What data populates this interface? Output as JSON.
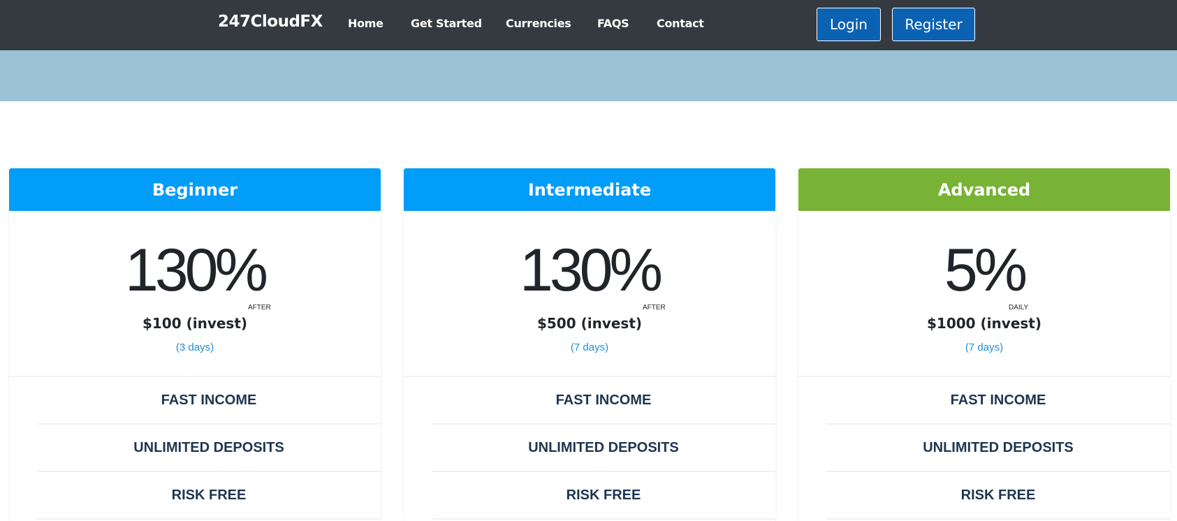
{
  "nav": {
    "brand": "247CloudFX",
    "links": [
      "Home",
      "Get Started",
      "Currencies",
      "FAQS",
      "Contact"
    ],
    "login_label": "Login",
    "register_label": "Register"
  },
  "colors": {
    "navbar": "#343a40",
    "hero_band": "#9cc2d6",
    "beginner_header": "#029cf9",
    "intermediate_header": "#029cf9",
    "advanced_header": "#79b336",
    "duration_text": "#1a8fd9"
  },
  "plans": [
    {
      "name": "Beginner",
      "rate": "130%",
      "tag": "AFTER",
      "invest": "$100 (invest)",
      "duration": "(3 days)",
      "features": [
        "FAST INCOME",
        "UNLIMITED DEPOSITS",
        "RISK FREE"
      ]
    },
    {
      "name": "Intermediate",
      "rate": "130%",
      "tag": "AFTER",
      "invest": "$500 (invest)",
      "duration": "(7 days)",
      "features": [
        "FAST INCOME",
        "UNLIMITED DEPOSITS",
        "RISK FREE"
      ]
    },
    {
      "name": "Advanced",
      "rate": "5%",
      "tag": "DAILY",
      "invest": "$1000 (invest)",
      "duration": "(7 days)",
      "features": [
        "FAST INCOME",
        "UNLIMITED DEPOSITS",
        "RISK FREE"
      ]
    }
  ]
}
